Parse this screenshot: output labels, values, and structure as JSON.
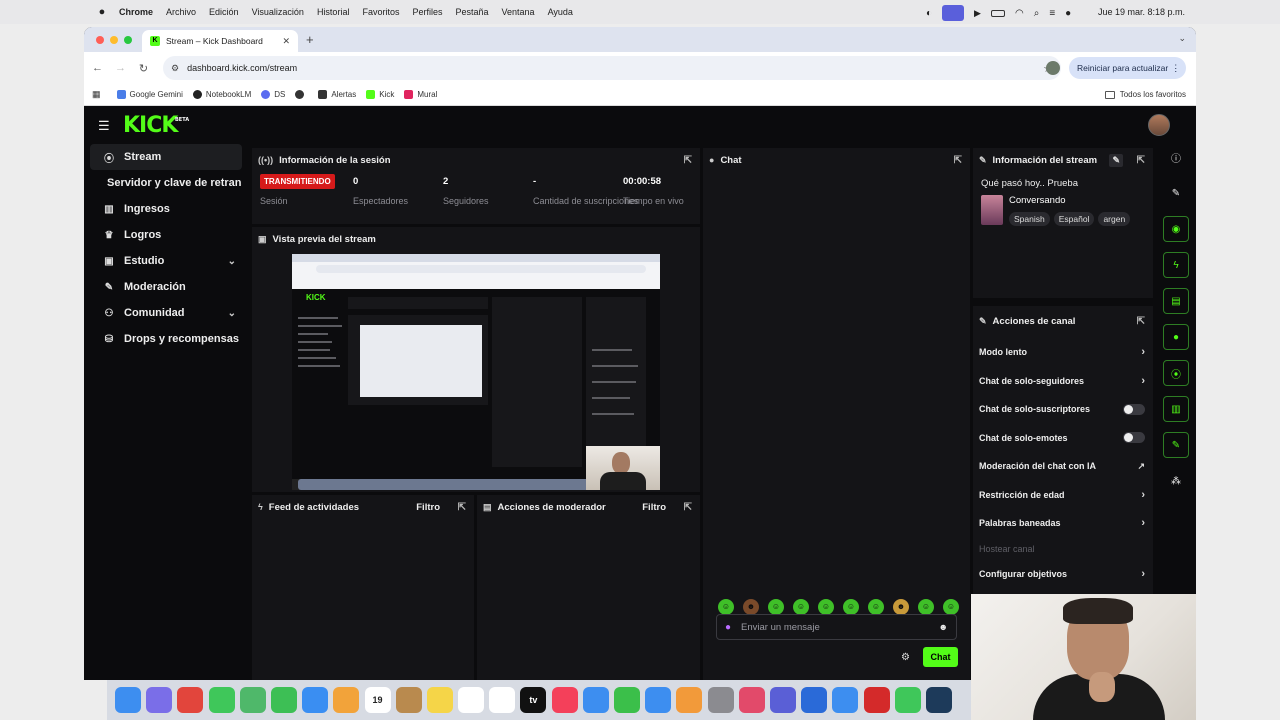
{
  "menubar": {
    "app": "Chrome",
    "items": [
      "Archivo",
      "Edición",
      "Visualización",
      "Historial",
      "Favoritos",
      "Perfiles",
      "Pestaña",
      "Ventana",
      "Ayuda"
    ],
    "clock": "Jue 19 mar. 8:18 p.m."
  },
  "browser": {
    "tab_title": "Stream – Kick Dashboard",
    "url": "dashboard.kick.com/stream",
    "reload_label": "Reiniciar para actualizar",
    "bookmarks": [
      {
        "label": "Google Gemini",
        "color": "#4a7de8"
      },
      {
        "label": "NotebookLM",
        "color": "#222222"
      },
      {
        "label": "DS",
        "color": "#5b6cf0"
      },
      {
        "label": "",
        "color": "#333333"
      },
      {
        "label": "Alertas",
        "color": "#333333"
      },
      {
        "label": "Kick",
        "color": "#53fc18"
      },
      {
        "label": "Mural",
        "color": "#e0245e"
      }
    ],
    "all_bookmarks": "Todos los favoritos"
  },
  "kick": {
    "logo": "KICK",
    "logo_badge": "BETA",
    "sidebar": [
      {
        "label": "Stream",
        "icon": "broadcast-icon",
        "glyph": "((•))",
        "active": true
      },
      {
        "label": "Servidor y clave de retransmisión",
        "sub": true
      },
      {
        "label": "Ingresos",
        "icon": "chart-icon",
        "glyph": "▥"
      },
      {
        "label": "Logros",
        "icon": "trophy-icon",
        "glyph": "🏆"
      },
      {
        "label": "Estudio",
        "icon": "studio-icon",
        "glyph": "▣",
        "expandable": true
      },
      {
        "label": "Moderación",
        "icon": "wrench-icon",
        "glyph": "🔧"
      },
      {
        "label": "Comunidad",
        "icon": "community-icon",
        "glyph": "👥",
        "expandable": true
      },
      {
        "label": "Drops y recompensas",
        "icon": "drops-icon",
        "glyph": "⛁"
      }
    ],
    "session": {
      "title": "Información de la sesión",
      "status": "TRANSMITIENDO",
      "status_label": "Sesión",
      "stats": [
        {
          "value": "0",
          "label": "Espectadores"
        },
        {
          "value": "2",
          "label": "Seguidores"
        },
        {
          "value": "-",
          "label": "Cantidad de suscripciones"
        },
        {
          "value": "00:00:58",
          "label": "Tiempo en vivo"
        }
      ]
    },
    "preview": {
      "title": "Vista previa del stream"
    },
    "activity": {
      "title": "Feed de actividades",
      "filter": "Filtro"
    },
    "modactions": {
      "title": "Acciones de moderador",
      "filter": "Filtro"
    },
    "chat": {
      "title": "Chat",
      "placeholder": "Enviar un mensaje",
      "send": "Chat"
    },
    "stream_info": {
      "title": "Información del stream",
      "stream_title": "Qué pasó hoy.. Prueba",
      "category": "Conversando",
      "tags": [
        "Spanish",
        "Español",
        "argen"
      ]
    },
    "channel_actions": {
      "title": "Acciones de canal",
      "items": [
        {
          "label": "Modo lento",
          "control": "arrow"
        },
        {
          "label": "Chat de solo-seguidores",
          "control": "arrow"
        },
        {
          "label": "Chat de solo-suscriptores",
          "control": "toggle"
        },
        {
          "label": "Chat de solo-emotes",
          "control": "toggle"
        },
        {
          "label": "Moderación del chat con IA",
          "control": "external"
        },
        {
          "label": "Restricción de edad",
          "control": "arrow"
        },
        {
          "label": "Palabras baneadas",
          "control": "arrow"
        },
        {
          "label": "Hostear canal",
          "control": "none",
          "disabled": true
        },
        {
          "label": "Configurar objetivos",
          "control": "arrow"
        }
      ]
    },
    "rail_icons": [
      "info-icon",
      "pencil-icon",
      "camera-icon",
      "bolt-icon",
      "note-icon",
      "chat-bubble-icon",
      "broadcast-icon",
      "layout-icon",
      "wrench-icon",
      "share-icon"
    ]
  },
  "dock": {
    "icons": [
      {
        "name": "finder-icon",
        "color": "#3d8ef0"
      },
      {
        "name": "launchpad-icon",
        "color": "#7a6ee8"
      },
      {
        "name": "chrome-icon",
        "color": "#e2453c"
      },
      {
        "name": "messages-icon",
        "color": "#3fc75a"
      },
      {
        "name": "maps-icon",
        "color": "#4fb86a"
      },
      {
        "name": "facetime-icon",
        "color": "#3dbf55"
      },
      {
        "name": "mail-icon",
        "color": "#3a8ef2"
      },
      {
        "name": "photos-icon",
        "color": "#f2a33a"
      },
      {
        "name": "calendar-icon",
        "color": "#ffffff",
        "text": "19"
      },
      {
        "name": "stickies-icon",
        "color": "#b98a4e"
      },
      {
        "name": "notes-icon",
        "color": "#f5d548"
      },
      {
        "name": "reminders-icon",
        "color": "#ffffff"
      },
      {
        "name": "freeform-icon",
        "color": "#ffffff"
      },
      {
        "name": "tv-icon",
        "color": "#111111",
        "text": "tv"
      },
      {
        "name": "music-icon",
        "color": "#f4405a"
      },
      {
        "name": "keynote-icon",
        "color": "#3d8ef0"
      },
      {
        "name": "numbers-icon",
        "color": "#3bbf4a"
      },
      {
        "name": "appstore-icon",
        "color": "#3d8ef0"
      },
      {
        "name": "pages-icon",
        "color": "#f29a3a"
      },
      {
        "name": "settings-icon",
        "color": "#8b8b90"
      },
      {
        "name": "clips-icon",
        "color": "#e24a6a"
      },
      {
        "name": "teams-icon",
        "color": "#5a5fd6"
      },
      {
        "name": "vscode-icon",
        "color": "#2a6ad8"
      },
      {
        "name": "safari-icon",
        "color": "#3d8ef0"
      },
      {
        "name": "acrobat-icon",
        "color": "#d42a2a"
      },
      {
        "name": "whatsapp-icon",
        "color": "#3fc75a"
      },
      {
        "name": "steam-icon",
        "color": "#1d3a5a"
      }
    ]
  }
}
